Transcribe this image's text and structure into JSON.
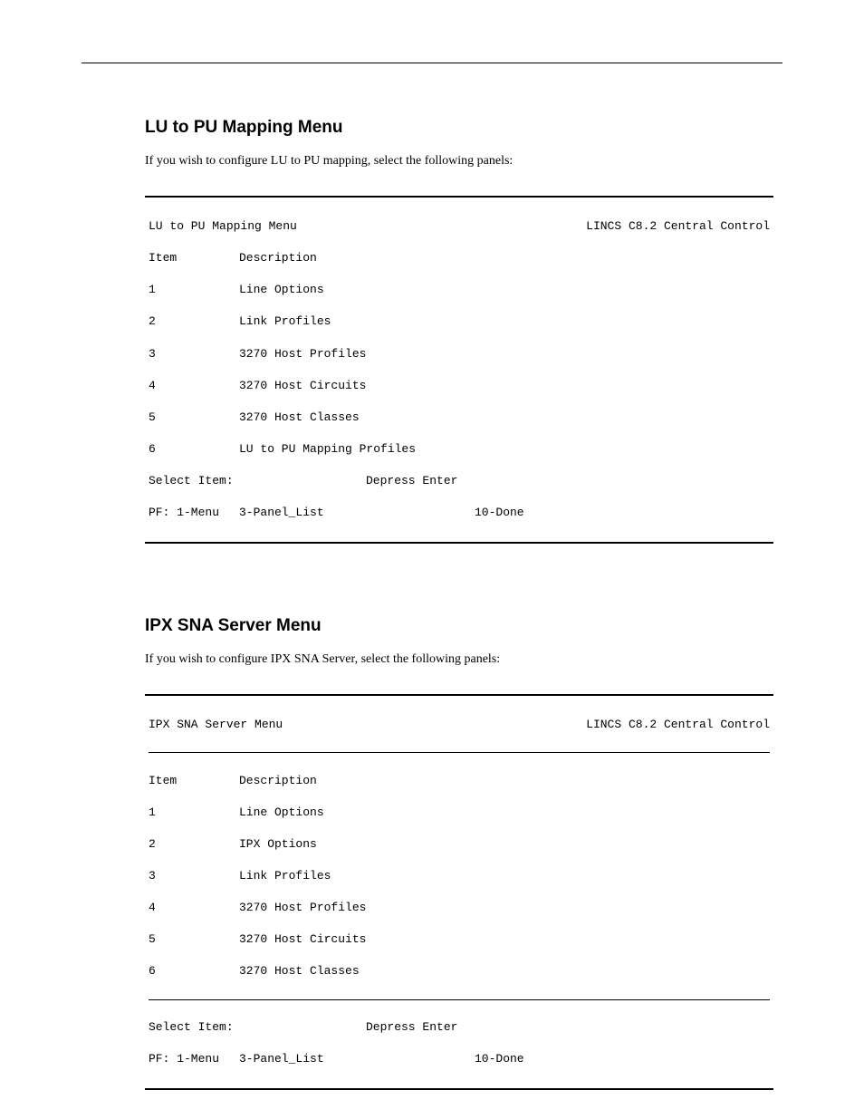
{
  "panel1": {
    "sectionTitle": "LU to PU Mapping Menu",
    "intro": "If you wish to configure LU to PU mapping, select the following panels:",
    "titleLeft": "LU to PU Mapping Menu",
    "titleRight": "LINCS C8.2 Central Control",
    "headerItem": "Item",
    "headerDesc": "Description",
    "items": [
      {
        "num": "1",
        "desc": "Line Options"
      },
      {
        "num": "2",
        "desc": "Link Profiles"
      },
      {
        "num": "3",
        "desc": "3270 Host Profiles"
      },
      {
        "num": "4",
        "desc": "3270 Host Circuits"
      },
      {
        "num": "5",
        "desc": "3270 Host Classes"
      },
      {
        "num": "6",
        "desc": "LU to PU Mapping Profiles"
      }
    ],
    "selectLabel": "Select Item:",
    "selectAction": "Depress Enter",
    "pfLeft": "PF: 1-Menu",
    "pfMid": "3-Panel_List",
    "pfRight": "10-Done"
  },
  "panel2": {
    "sectionTitle": "IPX SNA Server Menu",
    "intro": "If you wish to configure IPX SNA Server, select the following panels:",
    "titleLeft": "IPX SNA Server Menu",
    "titleRight": "LINCS C8.2 Central Control",
    "headerItem": "Item",
    "headerDesc": "Description",
    "items": [
      {
        "num": "1",
        "desc": "Line Options"
      },
      {
        "num": "2",
        "desc": "IPX Options"
      },
      {
        "num": "3",
        "desc": "Link Profiles"
      },
      {
        "num": "4",
        "desc": "3270 Host Profiles"
      },
      {
        "num": "5",
        "desc": "3270 Host Circuits"
      },
      {
        "num": "6",
        "desc": "3270 Host Classes"
      }
    ],
    "selectLabel": "Select Item:",
    "selectAction": "Depress Enter",
    "pfLeft": "PF: 1-Menu",
    "pfMid": "3-Panel_List",
    "pfRight": "10-Done"
  }
}
